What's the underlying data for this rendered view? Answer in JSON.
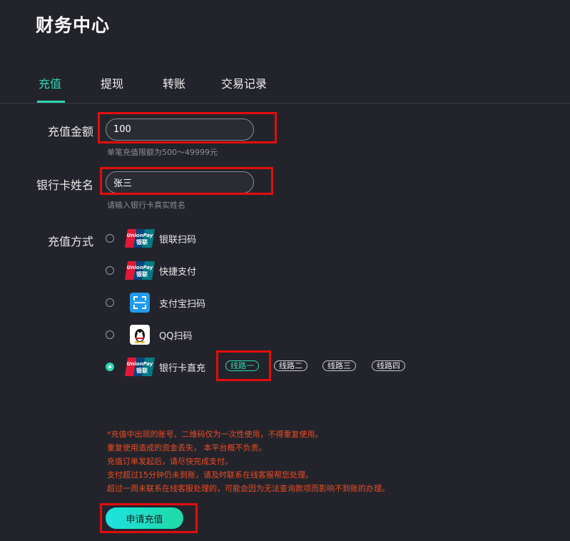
{
  "header": {
    "title": "财务中心"
  },
  "tabs": [
    {
      "label": "充值"
    },
    {
      "label": "提现"
    },
    {
      "label": "转账"
    },
    {
      "label": "交易记录"
    }
  ],
  "form": {
    "amount": {
      "label": "充值金额",
      "value": "100",
      "hint": "单笔充值限额为500～49999元"
    },
    "name": {
      "label": "银行卡姓名",
      "value": "张三",
      "hint": "请输入银行卡真实姓名"
    },
    "method": {
      "label": "充值方式",
      "options": [
        {
          "label": "银联扫码",
          "icon": "unionpay-icon",
          "checked": false
        },
        {
          "label": "快捷支付",
          "icon": "unionpay-icon",
          "checked": false
        },
        {
          "label": "支付宝扫码",
          "icon": "alipay-scan-icon",
          "checked": false
        },
        {
          "label": "QQ扫码",
          "icon": "qq-penguin-icon",
          "checked": false
        },
        {
          "label": "银行卡直充",
          "icon": "unionpay-icon",
          "checked": true
        }
      ],
      "lines": [
        "线路一",
        "线路二",
        "线路三",
        "线路四"
      ],
      "selected_line": "线路一"
    }
  },
  "notice": [
    "*充值中出现的账号、二维码仅为一次性使用，不得重复使用。",
    "重复使用造成的资金丢失， 本平台概不负责。",
    "充值订单发起后，请尽快完成支付。",
    "支付超过15分钟仍未到账，请及时联系在线客服帮您处理。",
    "超过一周未联系在线客服处理的，可能会因为无法查询款项而影响不到账的办理。"
  ],
  "submit_label": "申请充值",
  "colors": {
    "accent": "#2ed6b4",
    "warning": "#ef4a23",
    "highlight_box": "#e30d0d",
    "background": "#23242b"
  }
}
